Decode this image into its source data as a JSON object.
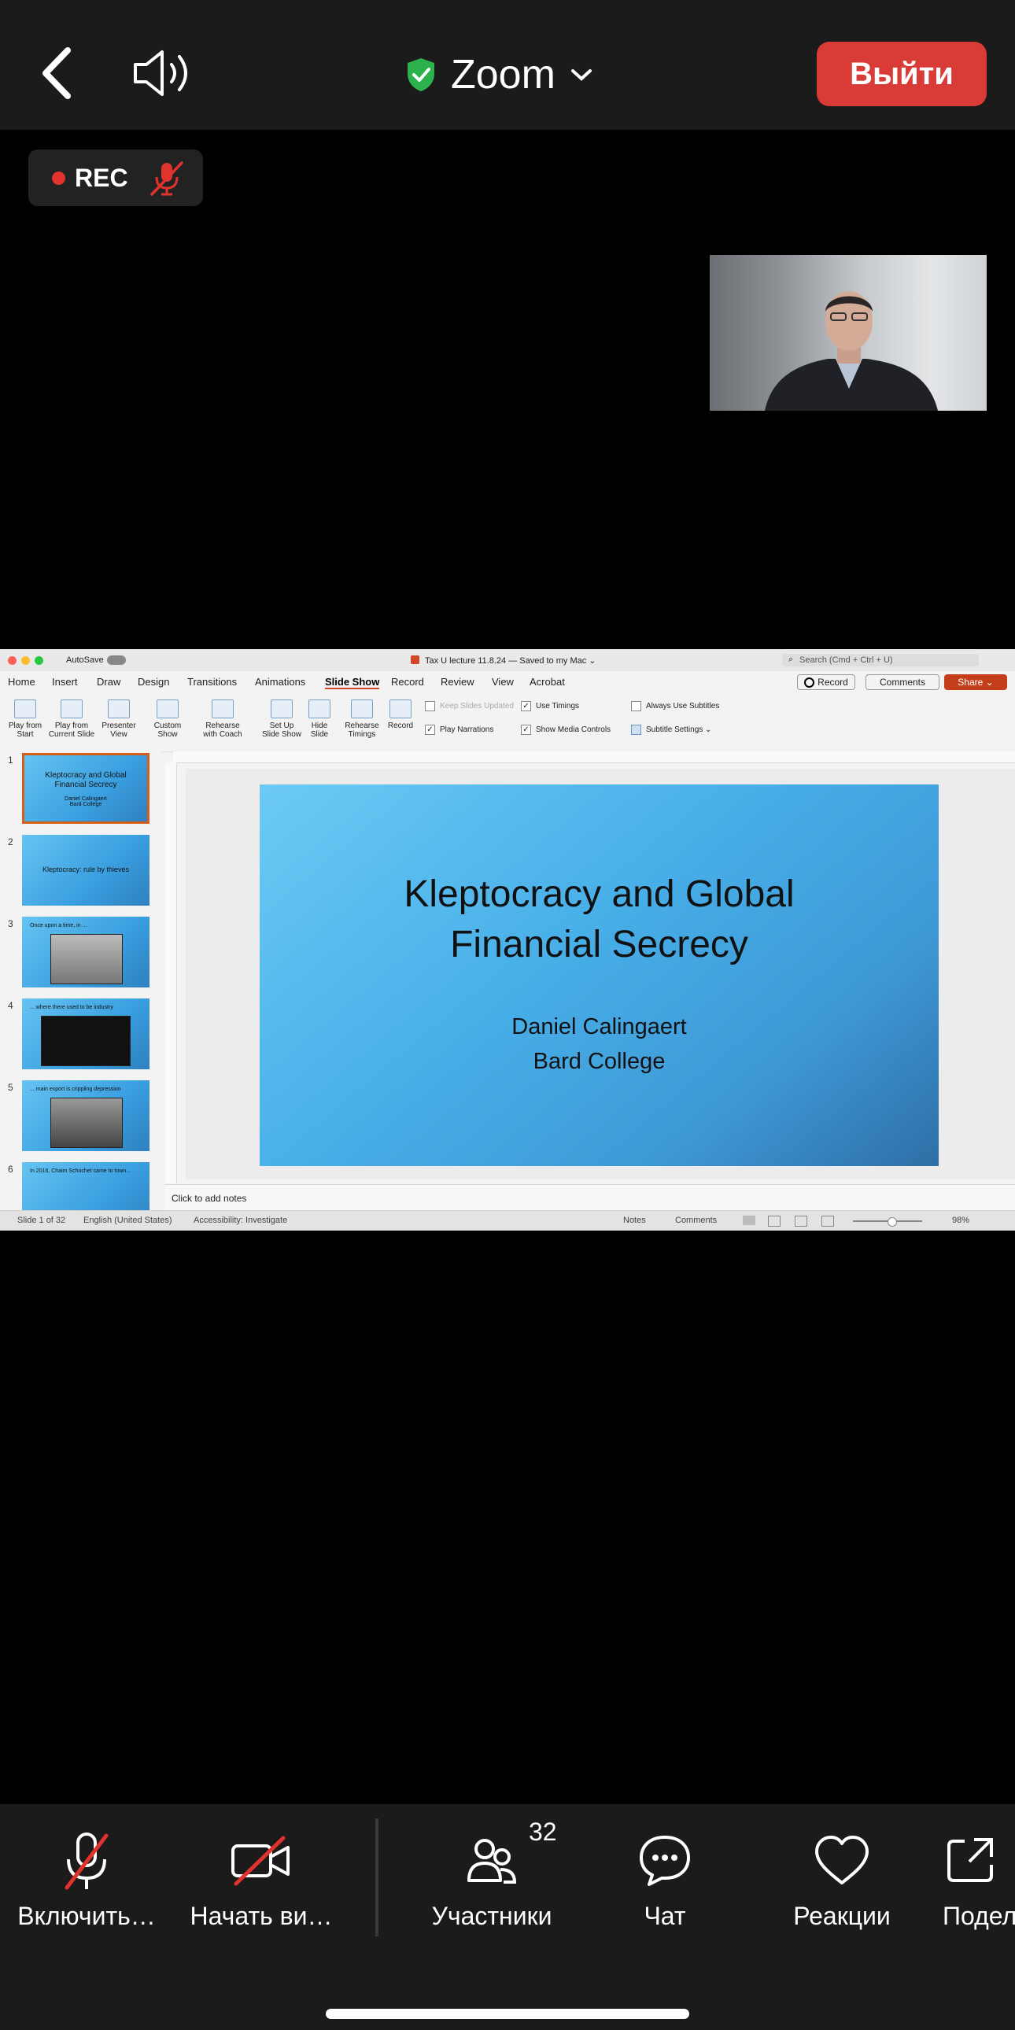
{
  "topbar": {
    "app_title": "Zoom",
    "leave_label": "Выйти"
  },
  "recording": {
    "label": "REC"
  },
  "window": {
    "autosave_label": "AutoSave",
    "doc_title": "Tax U lecture 11.8.24 — Saved to my Mac ⌄",
    "search_placeholder": "Search (Cmd + Ctrl + U)",
    "record_label": "Record",
    "comments_label": "Comments",
    "share_label": "Share ⌄"
  },
  "menu_tabs": [
    "Home",
    "Insert",
    "Draw",
    "Design",
    "Transitions",
    "Animations",
    "Slide Show",
    "Record",
    "Review",
    "View",
    "Acrobat"
  ],
  "ribbon": {
    "play_from_start": [
      "Play from",
      "Start"
    ],
    "play_from_current": [
      "Play from",
      "Current Slide"
    ],
    "presenter_view": [
      "Presenter",
      "View"
    ],
    "custom_show": [
      "Custom",
      "Show"
    ],
    "rehearse_with_coach": [
      "Rehearse",
      "with Coach"
    ],
    "set_up_slide_show": [
      "Set Up",
      "Slide Show"
    ],
    "hide_slide": [
      "Hide",
      "Slide"
    ],
    "rehearse_timings": [
      "Rehearse",
      "Timings"
    ],
    "record": "Record",
    "keep_slides_updated": "Keep Slides Updated",
    "use_timings": "Use Timings",
    "play_narrations": "Play Narrations",
    "show_media_controls": "Show Media Controls",
    "always_use_subtitles": "Always Use Subtitles",
    "subtitle_settings": "Subtitle Settings ⌄"
  },
  "thumbnails": [
    {
      "num": "1",
      "title": "Kleptocracy and Global Financial Secrecy",
      "sub": "Daniel Calingaert Bard College"
    },
    {
      "num": "2",
      "title": "Kleptocracy: rule by thieves"
    },
    {
      "num": "3",
      "caption": "Once upon a time, in ..."
    },
    {
      "num": "4",
      "caption": "... where there used to be industry"
    },
    {
      "num": "5",
      "caption": "... main export is crippling depression"
    },
    {
      "num": "6",
      "caption": "In 2016, Chaim Schochet came to town..."
    }
  ],
  "slide": {
    "title_line1": "Kleptocracy and Global",
    "title_line2": "Financial Secrecy",
    "author": "Daniel Calingaert",
    "institution": "Bard College"
  },
  "notes_placeholder": "Click to add notes",
  "status": {
    "slide_counter": "Slide 1 of 32",
    "language": "English (United States)",
    "accessibility": "Accessibility: Investigate",
    "notes": "Notes",
    "comments": "Comments",
    "zoom": "98%"
  },
  "bottom_toolbar": {
    "unmute": "Включить…",
    "start_video": "Начать ви…",
    "participants": "Участники",
    "participants_count": "32",
    "chat": "Чат",
    "reactions": "Реакции",
    "share": "Подел"
  }
}
